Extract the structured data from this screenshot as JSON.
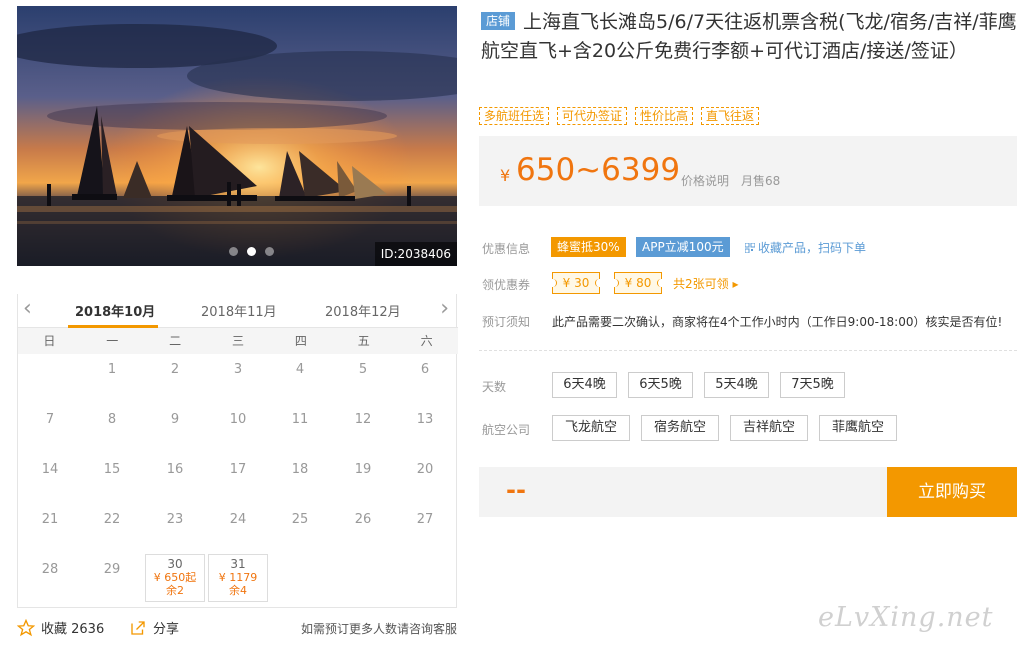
{
  "photo": {
    "id_label": "ID:2038406",
    "dots": 3,
    "active_dot": 1
  },
  "calendar": {
    "prev_icon": "chevron-left-icon",
    "next_icon": "chevron-right-icon",
    "months": [
      "2018年10月",
      "2018年11月",
      "2018年12月"
    ],
    "active_month": 0,
    "weekdays": [
      "日",
      "一",
      "二",
      "三",
      "四",
      "五",
      "六"
    ],
    "first_weekday": 1,
    "days_in_month": 31,
    "available": {
      "30": {
        "price": "¥ 650起",
        "left": "余2"
      },
      "31": {
        "price": "¥ 1179",
        "left": "余4"
      }
    }
  },
  "footer": {
    "fav_label": "收藏 2636",
    "share_label": "分享",
    "consult": "如需预订更多人数请咨询客服"
  },
  "product": {
    "store_badge": "店铺",
    "title": "上海直飞长滩岛5/6/7天往返机票含税(飞龙/宿务/吉祥/菲鹰航空直飞+含20公斤免费行李额+可代订酒店/接送/签证）",
    "tags": [
      "多航班任选",
      "可代办签证",
      "性价比高",
      "直飞往返"
    ]
  },
  "price": {
    "currency": "¥",
    "range": "650~6399",
    "note": "价格说明",
    "sold": "月售68"
  },
  "promo": {
    "label": "优惠信息",
    "tag1": "蜂蜜抵30%",
    "tag1_color": "#f39800",
    "tag2": "APP立减100元",
    "tag2_color": "#5b9bd5",
    "qr": "收藏产品，扫码下单"
  },
  "coupons": {
    "label": "领优惠券",
    "items": [
      "¥ 30",
      "¥ 80"
    ],
    "more": "共2张可领 ▸"
  },
  "notice": {
    "label": "预订须知",
    "text": "此产品需要二次确认，商家将在4个工作小时内（工作日9:00-18:00）核实是否有位!"
  },
  "days": {
    "label": "天数",
    "options": [
      "6天4晚",
      "6天5晚",
      "5天4晚",
      "7天5晚"
    ]
  },
  "airlines": {
    "label": "航空公司",
    "options": [
      "飞龙航空",
      "宿务航空",
      "吉祥航空",
      "菲鹰航空"
    ]
  },
  "buy": {
    "price_placeholder": "--",
    "button": "立即购买"
  },
  "watermark": "eLvXing.net",
  "colors": {
    "accent": "#f39800",
    "price": "#f0750f",
    "link": "#5b9bd5"
  }
}
